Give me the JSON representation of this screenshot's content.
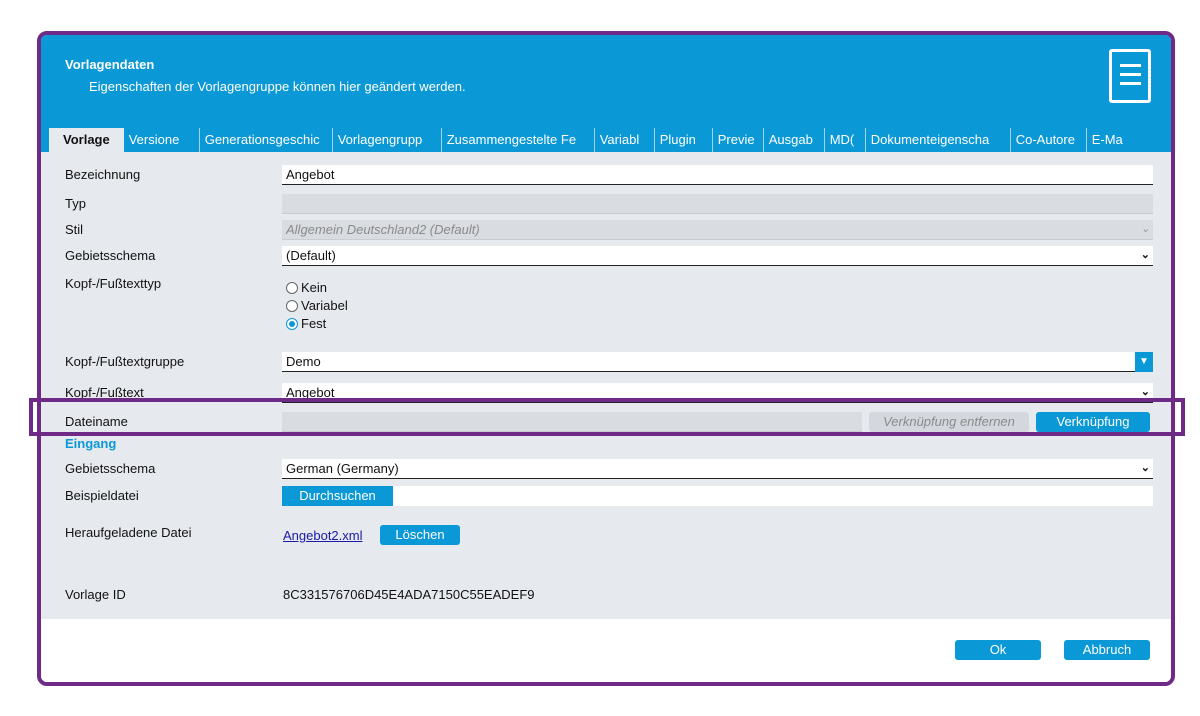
{
  "header": {
    "title": "Vorlagendaten",
    "subtitle": "Eigenschaften der Vorlagengruppe können hier geändert werden.",
    "icon": "document-icon"
  },
  "tabs": [
    {
      "label": "Vorlage",
      "active": true
    },
    {
      "label": "Versione"
    },
    {
      "label": "Generationsgeschic"
    },
    {
      "label": "Vorlagengrupp"
    },
    {
      "label": "Zusammengestelte Fe"
    },
    {
      "label": "Variabl"
    },
    {
      "label": "Plugin"
    },
    {
      "label": "Previe"
    },
    {
      "label": "Ausgab"
    },
    {
      "label": "MD("
    },
    {
      "label": "Dokumenteigenscha"
    },
    {
      "label": "Co-Autore"
    },
    {
      "label": "E-Ma"
    }
  ],
  "form": {
    "bezeichnung": {
      "label": "Bezeichnung",
      "value": "Angebot"
    },
    "typ": {
      "label": "Typ",
      "value": ""
    },
    "stil": {
      "label": "Stil",
      "value": "Allgemein Deutschland2 (Default)"
    },
    "gebietsschema": {
      "label": "Gebietsschema",
      "value": "(Default)"
    },
    "kopf_typ": {
      "label": "Kopf-/Fußtexttyp",
      "options": [
        {
          "label": "Kein",
          "checked": false
        },
        {
          "label": "Variabel",
          "checked": false
        },
        {
          "label": "Fest",
          "checked": true
        }
      ]
    },
    "kopf_gruppe": {
      "label": "Kopf-/Fußtextgruppe",
      "value": "Demo"
    },
    "kopf_text": {
      "label": "Kopf-/Fußtext",
      "value": "Angebot"
    },
    "dateiname": {
      "label": "Dateiname",
      "value": "",
      "remove_link_label": "Verknüpfung entfernen",
      "link_label": "Verknüpfung"
    }
  },
  "eingang": {
    "title": "Eingang",
    "gebietsschema": {
      "label": "Gebietsschema",
      "value": "German (Germany)"
    },
    "beispieldatei": {
      "label": "Beispieldatei",
      "button_label": "Durchsuchen"
    },
    "hochgeladen": {
      "label": "Heraufgeladene Datei",
      "file": "Angebot2.xml",
      "delete_label": "Löschen"
    },
    "vorlage_id": {
      "label": "Vorlage ID",
      "value": "8C331576706D45E4ADA7150C55EADEF9"
    }
  },
  "footer": {
    "ok_label": "Ok",
    "cancel_label": "Abbruch"
  },
  "colors": {
    "accent": "#0b98d6",
    "highlight_border": "#6e2a86",
    "panel_bg": "#e6e9ee"
  }
}
